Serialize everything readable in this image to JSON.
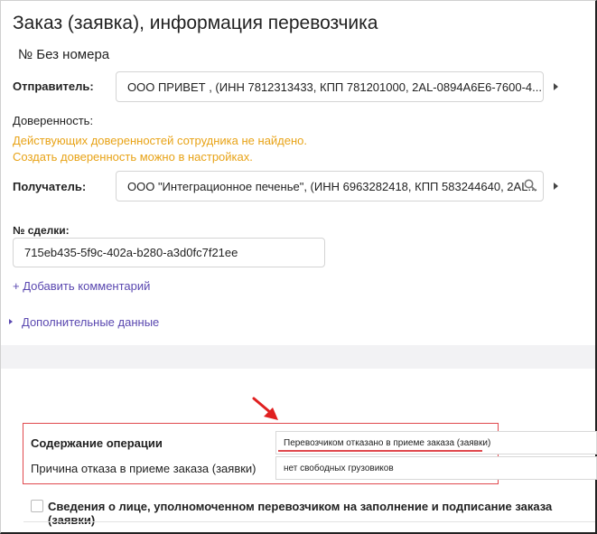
{
  "page_title": "Заказ (заявка), информация перевозчика",
  "order_number": "№ Без номера",
  "sender": {
    "label": "Отправитель:",
    "value": "ООО ПРИВЕТ , (ИНН 7812313433, КПП 781201000, 2AL-0894A6E6-7600-4..."
  },
  "power_of_attorney": {
    "label": "Доверенность:",
    "warning_line1": "Действующих доверенностей сотрудника не найдено.",
    "warning_line2": "Создать доверенность можно в настройках."
  },
  "recipient": {
    "label": "Получатель:",
    "value": "ООО \"Интеграционное печенье\", (ИНН 6963282418, КПП 583244640, 2AL..."
  },
  "deal": {
    "label": "№ сделки:",
    "value": "715eb435-5f9c-402a-b280-a3d0fc7f21ee"
  },
  "add_comment_label": "+ Добавить комментарий",
  "additional_data_label": "Дополнительные данные",
  "operation": {
    "content_label": "Содержание операции",
    "content_value": "Перевозчиком отказано в приеме заказа (заявки)",
    "reason_label": "Причина отказа в приеме заказа (заявки)",
    "reason_value": "нет свободных грузовиков"
  },
  "authorized_person_label": "Сведения о лице, уполномоченном перевозчиком на заполнение и подписание заказа (заявки)",
  "colors": {
    "accent": "#5a48b0",
    "warning": "#e8a317",
    "highlight_box": "#e0494e",
    "arrow": "#e02020"
  }
}
